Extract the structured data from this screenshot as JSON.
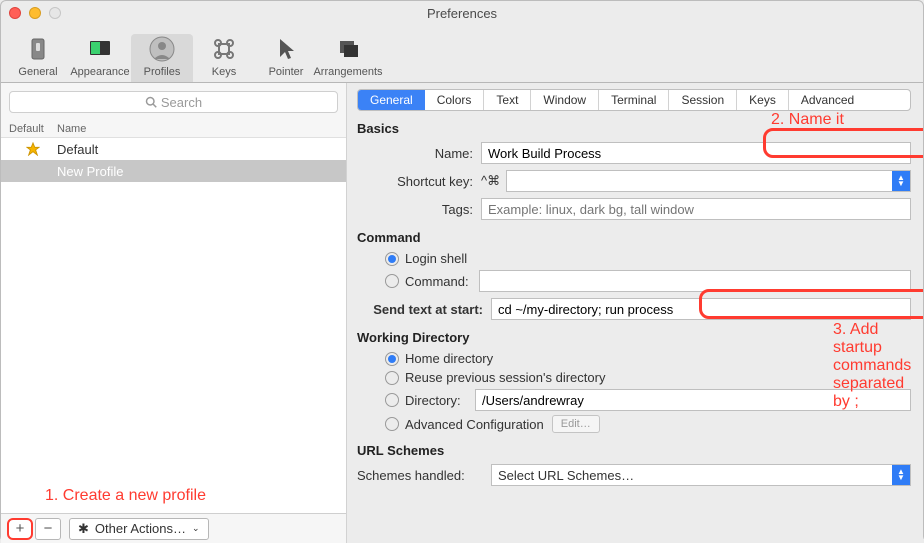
{
  "window": {
    "title": "Preferences"
  },
  "toolbar": {
    "items": [
      {
        "label": "General"
      },
      {
        "label": "Appearance"
      },
      {
        "label": "Profiles"
      },
      {
        "label": "Keys"
      },
      {
        "label": "Pointer"
      },
      {
        "label": "Arrangements"
      }
    ],
    "selected_index": 2
  },
  "sidebar": {
    "search_placeholder": "Search",
    "columns": {
      "default": "Default",
      "name": "Name"
    },
    "rows": [
      {
        "name": "Default",
        "is_default": true
      },
      {
        "name": "New Profile",
        "is_default": false,
        "selected": true
      }
    ],
    "other_actions_label": "Other Actions…"
  },
  "tabs": [
    "General",
    "Colors",
    "Text",
    "Window",
    "Terminal",
    "Session",
    "Keys",
    "Advanced"
  ],
  "tabs_selected_index": 0,
  "basics": {
    "section": "Basics",
    "name_label": "Name:",
    "name_value": "Work Build Process",
    "shortcut_label": "Shortcut key:",
    "shortcut_prefix": "^⌘",
    "tags_label": "Tags:",
    "tags_placeholder": "Example: linux, dark bg, tall window"
  },
  "command": {
    "section": "Command",
    "login_shell": "Login shell",
    "command_label": "Command:",
    "send_text_label": "Send text at start:",
    "send_text_value": "cd ~/my-directory; run process"
  },
  "working_dir": {
    "section": "Working Directory",
    "home": "Home directory",
    "reuse": "Reuse previous session's directory",
    "directory_label": "Directory:",
    "directory_value": "/Users/andrewray",
    "advanced": "Advanced Configuration",
    "edit_label": "Edit…"
  },
  "url_schemes": {
    "section": "URL Schemes",
    "label": "Schemes handled:",
    "placeholder": "Select URL Schemes…"
  },
  "annotations": {
    "a1": "1. Create a new profile",
    "a2": "2. Name it",
    "a3": "3. Add startup commands separated by ;"
  }
}
